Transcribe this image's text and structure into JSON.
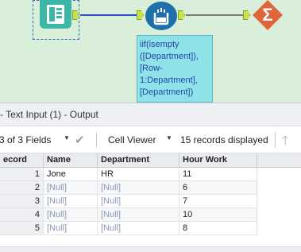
{
  "canvas": {
    "formula_annotation": "iif(isempty\n([Department]),\n[Row-\n1:Department],\n[Department])",
    "summarize_symbol": "Σ",
    "colors": {
      "canvas_bg": "#d9efd9",
      "input_tool": "#3cb7a7",
      "formula_tool": "#1f6fa8",
      "summarize_tool": "#e0653b",
      "annotation_bg": "#8fe3e8",
      "connector_left": "#2b4fc4",
      "connector_right": "#7a7a7a"
    }
  },
  "output": {
    "title": "- Text Input (1) - Output"
  },
  "toolbar": {
    "fields_label": "3 of 3 Fields",
    "viewer_label": "Cell Viewer",
    "records_label": "15 records displayed"
  },
  "grid": {
    "columns": [
      "ecord",
      "Name",
      "Department",
      "Hour Work"
    ],
    "rows": [
      {
        "record": "1",
        "name": "Jone",
        "department": "HR",
        "hours": "11"
      },
      {
        "record": "2",
        "name": "[Null]",
        "department": "[Null]",
        "hours": "6"
      },
      {
        "record": "3",
        "name": "[Null]",
        "department": "[Null]",
        "hours": "7"
      },
      {
        "record": "4",
        "name": "[Null]",
        "department": "[Null]",
        "hours": "10"
      },
      {
        "record": "5",
        "name": "[Null]",
        "department": "[Null]",
        "hours": "8"
      }
    ]
  }
}
